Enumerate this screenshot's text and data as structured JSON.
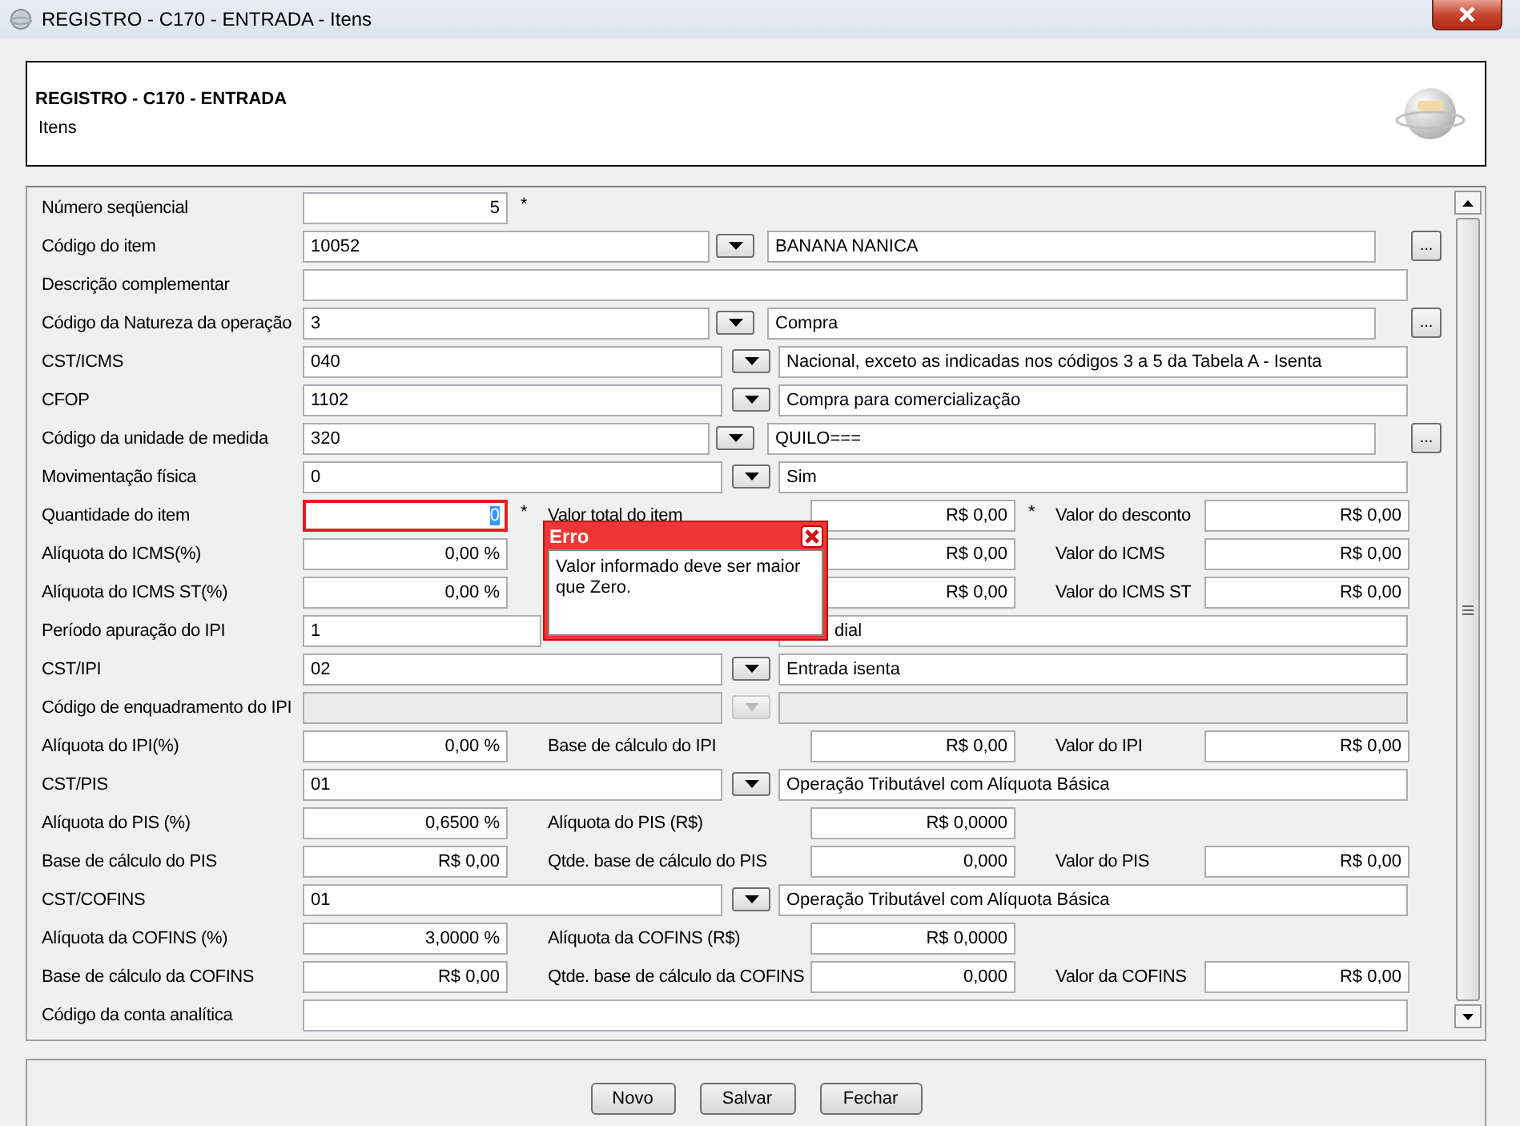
{
  "window": {
    "title": "REGISTRO - C170 - ENTRADA - Itens"
  },
  "header": {
    "title": "REGISTRO - C170 - ENTRADA",
    "subtitle": "Itens"
  },
  "rows": [
    {
      "kind": "single",
      "label": "Número seqüencial",
      "value": "5",
      "required_mark": "*"
    },
    {
      "kind": "lookup",
      "label": "Código do item",
      "code": "10052",
      "description": "BANANA NANICA",
      "browse_label": "..."
    },
    {
      "kind": "text",
      "label": "Descrição complementar"
    },
    {
      "kind": "lookup",
      "label": "Código da Natureza da operação",
      "code": "3",
      "description": "Compra",
      "browse_label": "..."
    },
    {
      "kind": "lookup",
      "label": "CST/ICMS",
      "code": "040",
      "description": "Nacional, exceto as indicadas nos códigos 3 a 5 da Tabela A - Isenta"
    },
    {
      "kind": "lookup",
      "label": "CFOP",
      "code": "1102",
      "description": "Compra para comercialização"
    },
    {
      "kind": "lookup",
      "label": "Código da unidade de medida",
      "code": "320",
      "description": "QUILO===",
      "browse_label": "..."
    },
    {
      "kind": "lookup",
      "label": "Movimentação física",
      "code": "0",
      "description": "Sim"
    },
    {
      "kind": "multi",
      "fields": [
        {
          "label": "Quantidade do item",
          "value": "0",
          "required_mark": "*",
          "invalid": true
        },
        {
          "label": "Valor total do item",
          "value": "R$ 0,00",
          "required_mark": "*"
        },
        {
          "label": "Valor do desconto",
          "value": "R$ 0,00"
        }
      ]
    },
    {
      "kind": "multi",
      "fields": [
        {
          "label": "Alíquota do ICMS(%)",
          "value": "0,00 %"
        },
        {
          "value": "R$ 0,00"
        },
        {
          "label": "Valor do ICMS",
          "value": "R$ 0,00"
        }
      ]
    },
    {
      "kind": "multi",
      "fields": [
        {
          "label": "Alíquota do ICMS ST(%)",
          "value": "0,00 %"
        },
        {
          "value": "R$ 0,00"
        },
        {
          "label": "Valor do ICMS ST",
          "value": "R$ 0,00"
        }
      ]
    },
    {
      "kind": "lookup",
      "label": "Período apuração do IPI",
      "code": "1",
      "description": "dial",
      "covered": true
    },
    {
      "kind": "lookup",
      "label": "CST/IPI",
      "code": "02",
      "description": "Entrada isenta"
    },
    {
      "kind": "lookup",
      "label": "Código de enquadramento do IPI",
      "disabled": true
    },
    {
      "kind": "multi",
      "fields": [
        {
          "label": "Alíquota do IPI(%)",
          "value": "0,00 %"
        },
        {
          "label": "Base de cálculo do IPI",
          "value": "R$ 0,00"
        },
        {
          "label": "Valor do IPI",
          "value": "R$ 0,00"
        }
      ]
    },
    {
      "kind": "lookup",
      "label": "CST/PIS",
      "code": "01",
      "description": "Operação Tributável com Alíquota Básica"
    },
    {
      "kind": "multi",
      "fields": [
        {
          "label": "Alíquota do PIS (%)",
          "value": "0,6500 %"
        },
        {
          "label": "Alíquota do PIS (R$)",
          "value": "R$ 0,0000"
        }
      ]
    },
    {
      "kind": "multi",
      "fields": [
        {
          "label": "Base de cálculo do PIS",
          "value": "R$ 0,00"
        },
        {
          "label": "Qtde. base de cálculo do PIS",
          "value": "0,000"
        },
        {
          "label": "Valor do PIS",
          "value": "R$ 0,00"
        }
      ]
    },
    {
      "kind": "lookup",
      "label": "CST/COFINS",
      "code": "01",
      "description": "Operação Tributável com Alíquota Básica"
    },
    {
      "kind": "multi",
      "fields": [
        {
          "label": "Alíquota da COFINS (%)",
          "value": "3,0000 %"
        },
        {
          "label": "Alíquota da COFINS (R$)",
          "value": "R$ 0,0000"
        }
      ]
    },
    {
      "kind": "multi",
      "fields": [
        {
          "label": "Base de cálculo da COFINS",
          "value": "R$ 0,00"
        },
        {
          "label": "Qtde. base de cálculo da COFINS",
          "value": "0,000"
        },
        {
          "label": "Valor da COFINS",
          "value": "R$ 0,00"
        }
      ]
    },
    {
      "kind": "text",
      "label": "Código da conta analítica"
    }
  ],
  "error_popup": {
    "title": "Erro",
    "message": "Valor informado deve ser maior que Zero."
  },
  "buttons": [
    "Novo",
    "Salvar",
    "Fechar"
  ]
}
